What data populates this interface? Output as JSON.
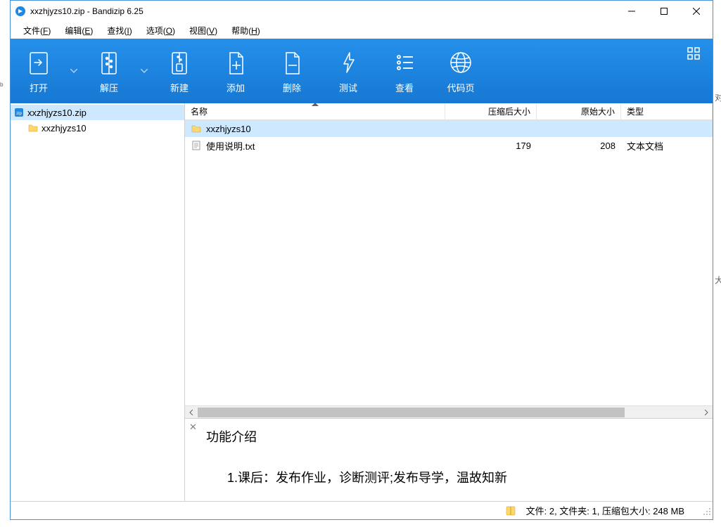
{
  "window": {
    "title": "xxzhjyzs10.zip - Bandizip 6.25"
  },
  "menu": {
    "file": "文件(<u>F</u>)",
    "edit": "编辑(<u>E</u>)",
    "find": "查找(<u>I</u>)",
    "options": "选项(<u>O</u>)",
    "view": "视图(<u>V</u>)",
    "help": "帮助(<u>H</u>)"
  },
  "toolbar": {
    "open": "打开",
    "extract": "解压",
    "new": "新建",
    "add": "添加",
    "delete": "删除",
    "test": "测试",
    "view": "查看",
    "codepage": "代码页"
  },
  "tree": {
    "root": "xxzhjyzs10.zip",
    "child": "xxzhjyzs10"
  },
  "columns": {
    "name": "名称",
    "compressed": "压缩后大小",
    "original": "原始大小",
    "type": "类型"
  },
  "rows": [
    {
      "name": "xxzhjyzs10",
      "compressed": "",
      "original": "",
      "type": "",
      "icon": "folder",
      "selected": true
    },
    {
      "name": "使用说明.txt",
      "compressed": "179",
      "original": "208",
      "type": "文本文档",
      "icon": "txt",
      "selected": false
    }
  ],
  "preview": {
    "title": "功能介绍",
    "line": "1.课后：发布作业，诊断测评;发布导学，温故知新"
  },
  "status": {
    "text": "文件: 2, 文件夹: 1, 压缩包大小: 248 MB"
  }
}
